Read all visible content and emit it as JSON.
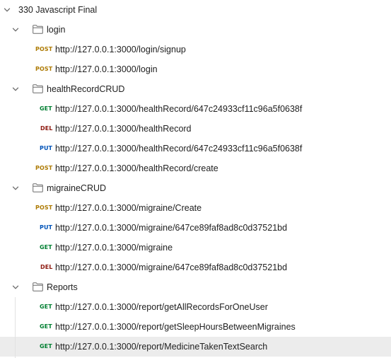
{
  "collection": {
    "name": "330 Javascript Final",
    "folders": [
      {
        "name": "login",
        "requests": [
          {
            "method": "POST",
            "url": "http://127.0.0.1:3000/login/signup"
          },
          {
            "method": "POST",
            "url": "http://127.0.0.1:3000/login"
          }
        ]
      },
      {
        "name": "healthRecordCRUD",
        "requests": [
          {
            "method": "GET",
            "url": "http://127.0.0.1:3000/healthRecord/647c24933cf11c96a5f0638f"
          },
          {
            "method": "DEL",
            "url": "http://127.0.0.1:3000/healthRecord"
          },
          {
            "method": "PUT",
            "url": "http://127.0.0.1:3000/healthRecord/647c24933cf11c96a5f0638f"
          },
          {
            "method": "POST",
            "url": "http://127.0.0.1:3000/healthRecord/create"
          }
        ]
      },
      {
        "name": "migraineCRUD",
        "requests": [
          {
            "method": "POST",
            "url": "http://127.0.0.1:3000/migraine/Create"
          },
          {
            "method": "PUT",
            "url": "http://127.0.0.1:3000/migraine/647ce89faf8ad8c0d37521bd"
          },
          {
            "method": "GET",
            "url": "http://127.0.0.1:3000/migraine"
          },
          {
            "method": "DEL",
            "url": "http://127.0.0.1:3000/migraine/647ce89faf8ad8c0d37521bd"
          }
        ]
      },
      {
        "name": "Reports",
        "requests": [
          {
            "method": "GET",
            "url": "http://127.0.0.1:3000/report/getAllRecordsForOneUser"
          },
          {
            "method": "GET",
            "url": "http://127.0.0.1:3000/report/getSleepHoursBetweenMigraines"
          },
          {
            "method": "GET",
            "url": "http://127.0.0.1:3000/report/MedicineTakenTextSearch",
            "selected": true
          }
        ]
      }
    ]
  },
  "method_colors": {
    "POST": "#ad7a03",
    "GET": "#007f31",
    "DEL": "#8e1a10",
    "PUT": "#0053b8"
  },
  "icons": {
    "expanded": "chevron-down-icon",
    "folder": "folder-icon"
  }
}
